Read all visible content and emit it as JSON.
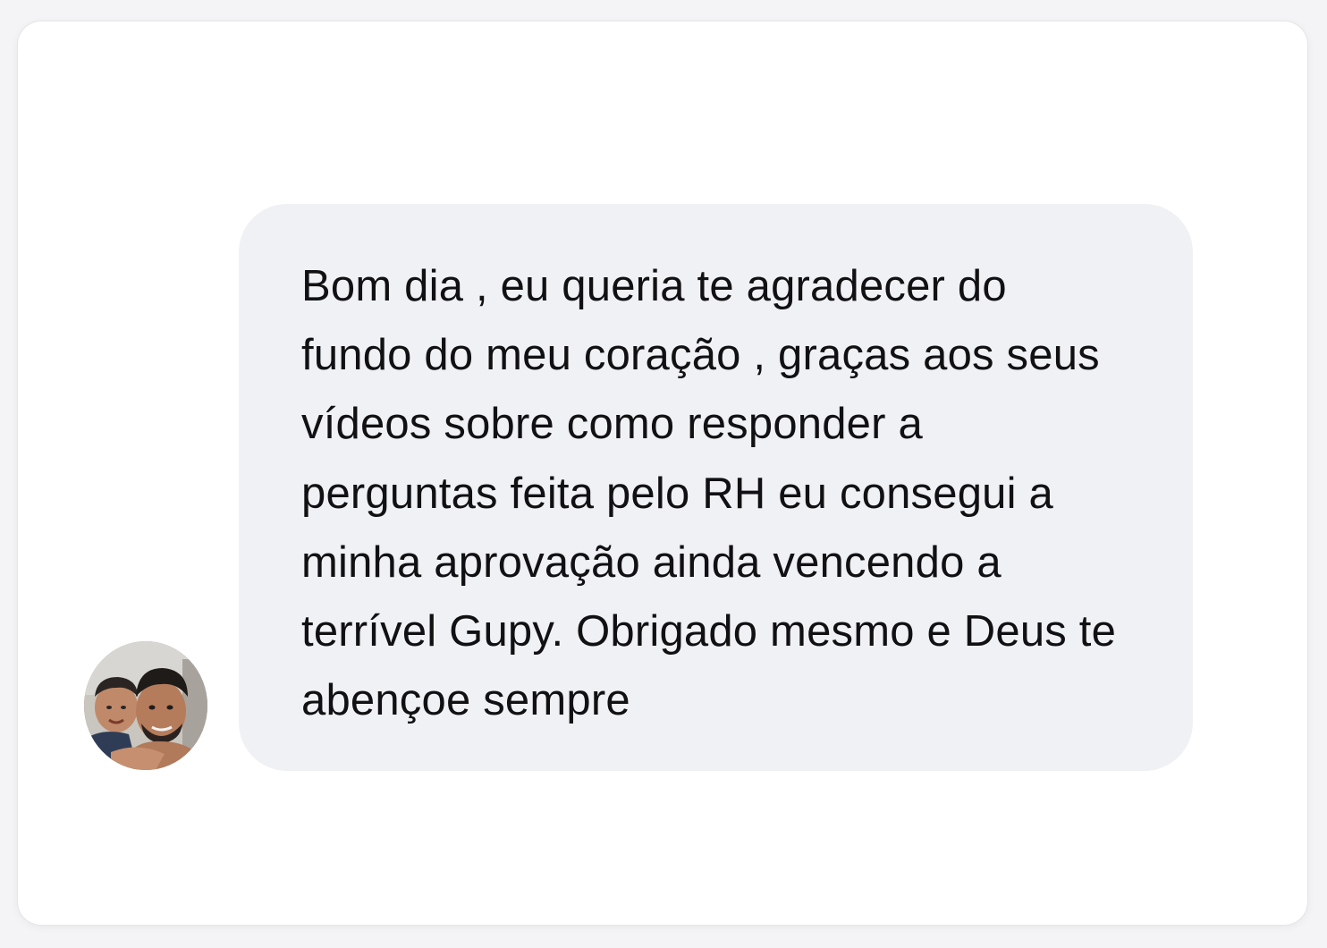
{
  "conversation": {
    "avatar_icon": "user-avatar-photo",
    "message": {
      "text": "Bom dia , eu queria te agradecer do\nfundo do meu coração , graças aos seus\nvídeos sobre como responder a\nperguntas feita pelo RH eu consegui a\nminha aprovação ainda vencendo a\nterrível Gupy. Obrigado mesmo e Deus te\nabençoe sempre"
    }
  },
  "colors": {
    "page_background": "#f4f4f6",
    "card_background": "#ffffff",
    "bubble_background": "#f0f1f4",
    "text": "#111114"
  }
}
